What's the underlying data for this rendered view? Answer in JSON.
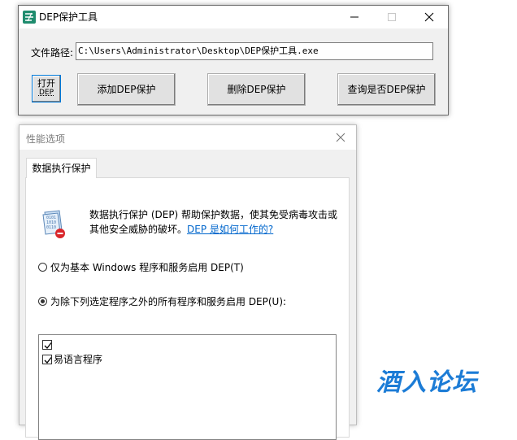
{
  "tool_window": {
    "title": "DEP保护工具",
    "path_label": "文件路径:",
    "path_value": "C:\\Users\\Administrator\\Desktop\\DEP保护工具.exe",
    "open_button": {
      "line1": "打开",
      "line2": "DEP"
    },
    "add_button": "添加DEP保护",
    "delete_button": "删除DEP保护",
    "query_button": "查询是否DEP保护"
  },
  "perf_window": {
    "title": "性能选项",
    "tab": "数据执行保护",
    "description": "数据执行保护 (DEP) 帮助保护数据，使其免受病毒攻击或其他安全威胁的破坏。",
    "link": "DEP 是如何工作的?",
    "radio_basic": "仅为基本 Windows 程序和服务启用 DEP(T)",
    "radio_all": "为除下列选定程序之外的所有程序和服务启用 DEP(U):",
    "selected_radio": "radio_all",
    "list_items": [
      {
        "label": "",
        "checked": true
      },
      {
        "label": "易语言程序",
        "checked": true
      }
    ]
  },
  "watermark": "酒入论坛",
  "colors": {
    "link": "#0066cc",
    "watermark": "#1c7cd6",
    "focus_border": "#0078d7"
  }
}
